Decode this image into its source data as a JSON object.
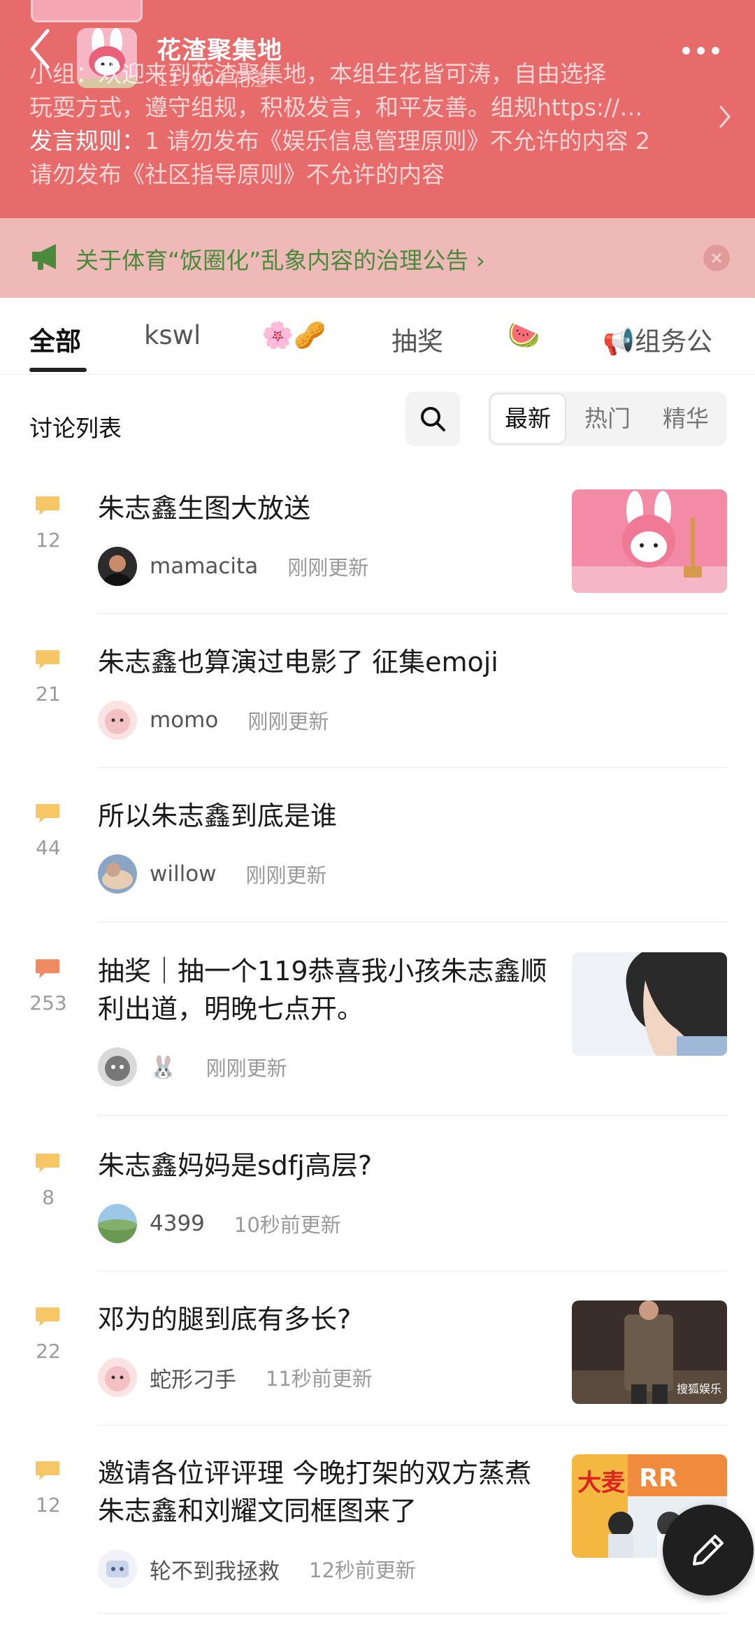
{
  "header": {
    "title": "花渣聚集地",
    "member_count": "117904 花渣",
    "description_line1": "小组：欢迎来到花渣聚集地，本组生花皆可涛，自由选择",
    "description_line2": "玩耍方式，遵守组规，积极发言，和平友善。组规https://…",
    "rules_label": "发言规则：",
    "rules_line1": "1 请勿发布《娱乐信息管理原则》不允许的内容 2",
    "rules_line2": "请勿发布《社区指导原则》不允许的内容",
    "bg_color": "#e86b6c"
  },
  "notice": {
    "text": "关于体育“饭圈化”乱象内容的治理公告",
    "chevron": "›",
    "text_color": "#4a8a3c"
  },
  "tabs": [
    {
      "label": "全部",
      "active": true
    },
    {
      "label": "kswl",
      "active": false
    },
    {
      "label": "🌸🥜",
      "active": false
    },
    {
      "label": "抽奖",
      "active": false
    },
    {
      "label": "🍉",
      "active": false
    },
    {
      "label": "📢组务公",
      "active": false
    }
  ],
  "filter": {
    "label": "讨论列表",
    "options": [
      "最新",
      "热门",
      "精华"
    ],
    "selected": "最新"
  },
  "posts": [
    {
      "count": "12",
      "title": "朱志鑫生图大放送",
      "user": "mamacita",
      "time": "刚刚更新",
      "has_thumb": true,
      "hot": false
    },
    {
      "count": "21",
      "title": "朱志鑫也算演过电影了 征集emoji",
      "user": "momo",
      "time": "刚刚更新",
      "has_thumb": false,
      "hot": false
    },
    {
      "count": "44",
      "title": "所以朱志鑫到底是谁",
      "user": "willow",
      "time": "刚刚更新",
      "has_thumb": false,
      "hot": false
    },
    {
      "count": "253",
      "title": "抽奖｜抽一个119恭喜我小孩朱志鑫顺利出道，明晚七点开。",
      "user": "🐰",
      "time": "刚刚更新",
      "has_thumb": true,
      "hot": true
    },
    {
      "count": "8",
      "title": "朱志鑫妈妈是sdfj高层?",
      "user": "4399",
      "time": "10秒前更新",
      "has_thumb": false,
      "hot": false
    },
    {
      "count": "22",
      "title": "邓为的腿到底有多长?",
      "user": "蛇形刁手",
      "time": "11秒前更新",
      "has_thumb": true,
      "hot": false
    },
    {
      "count": "12",
      "title": "邀请各位评评理 今晚打架的双方蒸煮 朱志鑫和刘耀文同框图来了",
      "user": "轮不到我拯救",
      "time": "12秒前更新",
      "has_thumb": true,
      "hot": false
    }
  ],
  "thumb_text": {
    "watermark_3": "搜狐娱乐",
    "sign_4": "大麦",
    "letters_4": "RR"
  },
  "colors": {
    "bubble": "#f6c667",
    "bubble_hot": "#f08a62",
    "accent_dark": "#1f1f1f"
  },
  "icons": [
    "back-arrow-icon",
    "more-dots-icon",
    "chevron-right-icon",
    "megaphone-icon",
    "close-icon",
    "search-icon",
    "comment-bubble-icon",
    "pen-icon"
  ]
}
